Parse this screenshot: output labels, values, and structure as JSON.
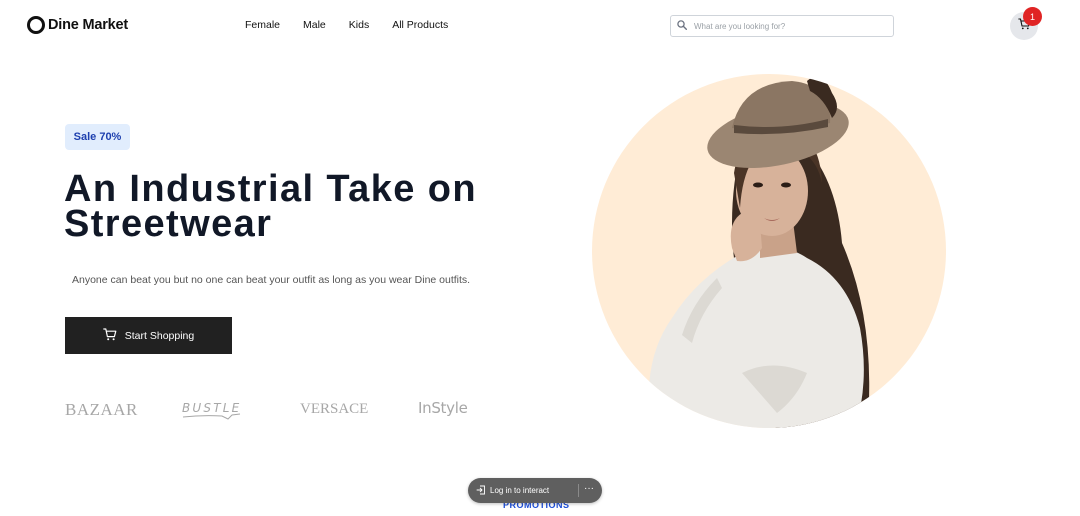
{
  "brand": {
    "name": "Dine Market"
  },
  "nav": {
    "items": [
      {
        "label": "Female"
      },
      {
        "label": "Male"
      },
      {
        "label": "Kids"
      },
      {
        "label": "All Products"
      }
    ]
  },
  "search": {
    "placeholder": "What are you looking for?",
    "value": ""
  },
  "cart": {
    "count": "1"
  },
  "hero": {
    "badge": "Sale 70%",
    "title_line1": "An Industrial Take on",
    "title_line2": "Streetwear",
    "subtitle": "Anyone can beat you but no one can beat your outfit as long as you wear Dine outfits.",
    "cta_label": "Start Shopping",
    "image_bg_color": "#ffecd6"
  },
  "featured_brands": [
    {
      "name": "BAZAAR"
    },
    {
      "name": "BUSTLE"
    },
    {
      "name": "VERSACE"
    },
    {
      "name": "InStyle"
    }
  ],
  "next_section": {
    "label": "PROMOTIONS"
  },
  "overlay": {
    "login_label": "Log in to interact",
    "more_label": "···"
  },
  "colors": {
    "accent": "#212121",
    "badge_bg": "#e1edfd",
    "badge_text": "#1e40af",
    "cart_badge": "#e02424",
    "link_blue": "#1d4ed8"
  }
}
